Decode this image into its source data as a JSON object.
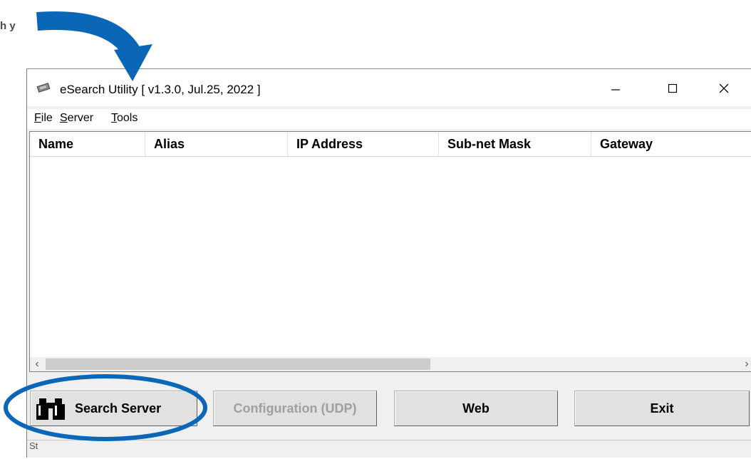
{
  "background": {
    "fragment_text": "h\ny"
  },
  "window": {
    "title": "eSearch Utility [ v1.3.0, Jul.25, 2022 ]",
    "controls": {
      "minimize": "—",
      "maximize": "☐",
      "close": "✕"
    }
  },
  "menu": {
    "file": {
      "accel": "F",
      "rest": "ile"
    },
    "server": {
      "accel": "S",
      "rest": "erver"
    },
    "tools": {
      "accel": "T",
      "rest": "ools"
    }
  },
  "table": {
    "columns": [
      "Name",
      "Alias",
      "IP Address",
      "Sub-net Mask",
      "Gateway"
    ],
    "rows": []
  },
  "scrollbar": {
    "left": "‹",
    "right": "›"
  },
  "buttons": {
    "search": "Search Server",
    "config": "Configuration (UDP)",
    "web": "Web",
    "exit": "Exit"
  },
  "status": {
    "text": "St"
  },
  "colors": {
    "annotation": "#0a66b7"
  }
}
